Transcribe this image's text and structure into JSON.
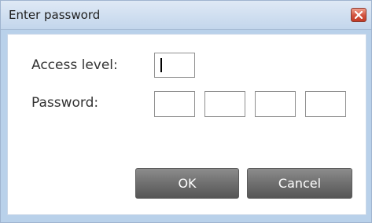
{
  "dialog": {
    "title": "Enter password",
    "close_icon": "close-icon"
  },
  "form": {
    "access_level_label": "Access level:",
    "access_level_value": "",
    "password_label": "Password:",
    "password_fields": [
      "",
      "",
      "",
      ""
    ]
  },
  "buttons": {
    "ok_label": "OK",
    "cancel_label": "Cancel"
  },
  "colors": {
    "title_bar": "#c3d6ec",
    "close_button": "#d1523e",
    "button_face": "#6f6f6f",
    "button_text": "#ffffff"
  }
}
